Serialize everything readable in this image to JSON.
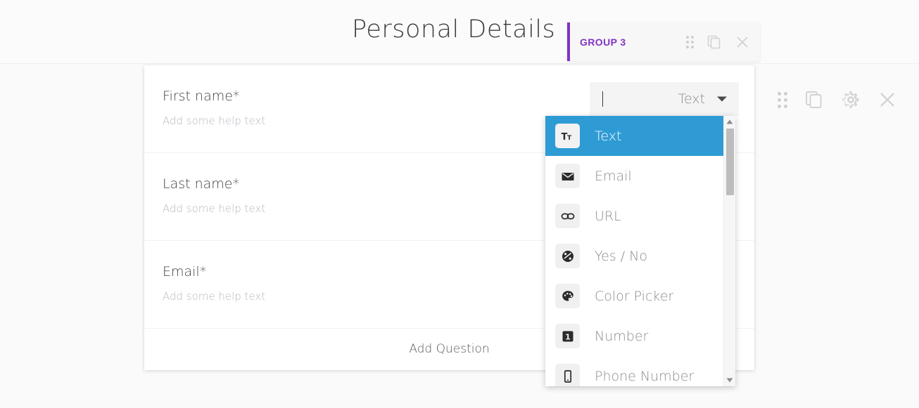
{
  "header": {
    "title": "Personal Details",
    "group_chip": {
      "label": "GROUP 3",
      "accent_color": "#8134c5",
      "actions": [
        {
          "name": "drag-handle-icon",
          "label": "Drag"
        },
        {
          "name": "duplicate-icon",
          "label": "Duplicate"
        },
        {
          "name": "close-icon",
          "label": "Close"
        }
      ]
    }
  },
  "card": {
    "questions": [
      {
        "label": "First name*",
        "help": "Add some help text"
      },
      {
        "label": "Last name*",
        "help": "Add some help text"
      },
      {
        "label": "Email*",
        "help": "Add some help text"
      }
    ],
    "add_question_label": "Add Question"
  },
  "type_select": {
    "value": "Text",
    "input_value": "",
    "arrow_icon": "chevron-down-icon"
  },
  "row_actions": [
    {
      "name": "drag-handle-icon",
      "label": "Drag"
    },
    {
      "name": "duplicate-icon",
      "label": "Duplicate"
    },
    {
      "name": "settings-icon",
      "label": "Settings"
    },
    {
      "name": "close-icon",
      "label": "Close"
    }
  ],
  "dropdown": {
    "selected": "Text",
    "highlight_color": "#2e9bd4",
    "items": [
      {
        "label": "Text",
        "icon": "text-format-icon",
        "selected": true
      },
      {
        "label": "Email",
        "icon": "envelope-icon",
        "selected": false
      },
      {
        "label": "URL",
        "icon": "link-icon",
        "selected": false
      },
      {
        "label": "Yes / No",
        "icon": "yes-no-toggle-icon",
        "selected": false
      },
      {
        "label": "Color Picker",
        "icon": "palette-icon",
        "selected": false
      },
      {
        "label": "Number",
        "icon": "number-one-icon",
        "selected": false
      },
      {
        "label": "Phone Number",
        "icon": "mobile-phone-icon",
        "selected": false
      }
    ],
    "scrollbar": {
      "up_icon": "scroll-up-arrow-icon",
      "down_icon": "scroll-down-arrow-icon"
    }
  }
}
